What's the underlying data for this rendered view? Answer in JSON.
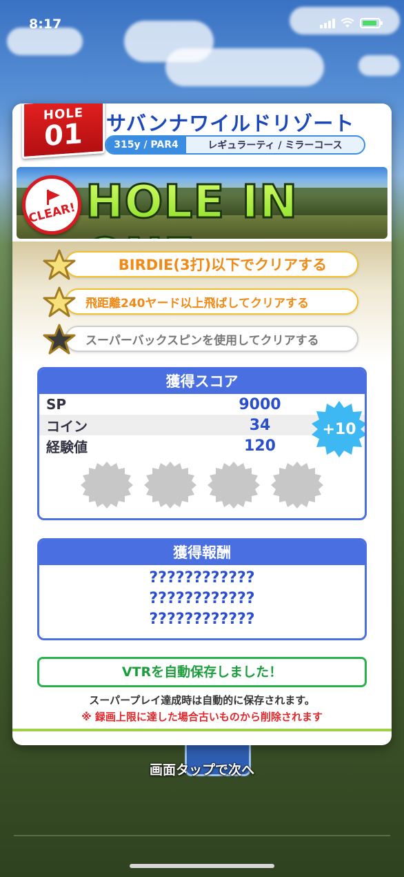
{
  "status_bar": {
    "time": "8:17"
  },
  "header": {
    "hole_label": "HOLE",
    "hole_number": "01",
    "course_name": "サバンナワイルドリゾート",
    "yardage_par": "315y / PAR4",
    "tee_course": "レギュラーティ / ミラーコース"
  },
  "banner": {
    "clear_badge": "CLEAR!",
    "result": "HOLE IN ONE"
  },
  "missions": [
    {
      "text": "BIRDIE(3打)以下でクリアする",
      "achieved": true
    },
    {
      "text": "飛距離240ヤード以上飛ばしてクリアする",
      "achieved": true
    },
    {
      "text": "スーパーバックスピンを使用してクリアする",
      "achieved": false
    }
  ],
  "score": {
    "title": "獲得スコア",
    "rows": [
      {
        "label": "SP",
        "value": "9000"
      },
      {
        "label": "コイン",
        "value": "34"
      },
      {
        "label": "経験値",
        "value": "120"
      }
    ],
    "bonus": "+10",
    "medal_slots": 4
  },
  "reward": {
    "title": "獲得報酬",
    "items": [
      "????????????",
      "????????????",
      "????????????"
    ]
  },
  "vtr": {
    "message": "VTRを自動保存しました！",
    "note": "スーパープレイ達成時は自動的に保存されます。",
    "warning": "※ 録画上限に達した場合古いものから削除されます"
  },
  "footer": {
    "tap_hint": "画面タップで次へ"
  },
  "colors": {
    "accent_blue": "#4a6fe0",
    "mission_gold": "#f08a16",
    "vtr_green": "#1c9c3c",
    "warning_red": "#e0282c",
    "flag_red": "#d81b21"
  }
}
